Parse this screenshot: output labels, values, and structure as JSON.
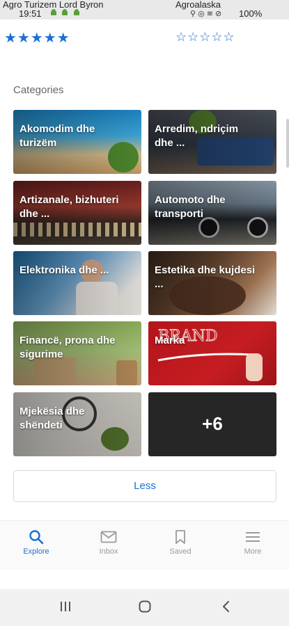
{
  "status_bar": {
    "left_title": "Agro Turizem Lord Byron",
    "right_title": "Agroalaska",
    "time": "19:51",
    "battery": "100%"
  },
  "ratings": {
    "left": "★★★★★",
    "right": "☆☆☆☆☆"
  },
  "section_title": "Categories",
  "categories": [
    {
      "label": "Akomodim dhe turizëm"
    },
    {
      "label": "Arredim, ndriçim dhe ..."
    },
    {
      "label": "Artizanale, bizhuteri dhe ..."
    },
    {
      "label": "Automoto dhe transporti"
    },
    {
      "label": "Elektronika dhe ..."
    },
    {
      "label": "Estetika dhe kujdesi ..."
    },
    {
      "label": "Financë, prona dhe sigurime"
    },
    {
      "label": "Marka"
    },
    {
      "label": "Mjekësia dhe shëndeti"
    }
  ],
  "more_tile": "+6",
  "less_button": "Less",
  "bottom_nav": [
    {
      "label": "Explore",
      "icon": "search-icon"
    },
    {
      "label": "Inbox",
      "icon": "mail-icon"
    },
    {
      "label": "Saved",
      "icon": "bookmark-icon"
    },
    {
      "label": "More",
      "icon": "menu-icon"
    }
  ],
  "colors": {
    "accent": "#1a6fd6",
    "inactive": "#9a9a9a"
  }
}
